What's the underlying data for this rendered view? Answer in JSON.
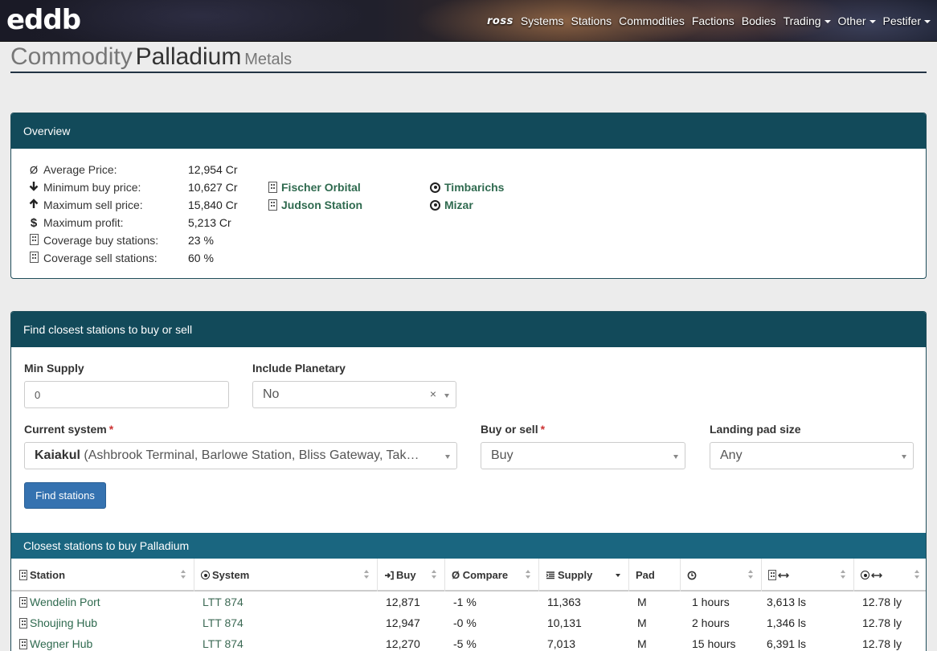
{
  "navbar": {
    "logo": "eddb",
    "brand": "ross",
    "items": [
      "Systems",
      "Stations",
      "Commodities",
      "Factions",
      "Bodies"
    ],
    "dropdowns": [
      "Trading",
      "Other",
      "Pestifer"
    ]
  },
  "header": {
    "prefix": "Commodity",
    "name": "Palladium",
    "category": "Metals"
  },
  "overview": {
    "title": "Overview",
    "rows": [
      {
        "icon": "Ø",
        "label": "Average Price:",
        "value": "12,954 Cr"
      },
      {
        "icon": "arrow-down-icon",
        "label": "Minimum buy price:",
        "value": "10,627 Cr"
      },
      {
        "icon": "arrow-up-icon",
        "label": "Maximum sell price:",
        "value": "15,840 Cr"
      },
      {
        "icon": "dollar-icon",
        "label": "Maximum profit:",
        "value": "5,213 Cr"
      },
      {
        "icon": "building-icon",
        "label": "Coverage buy stations:",
        "value": "23 %"
      },
      {
        "icon": "building-icon",
        "label": "Coverage sell stations:",
        "value": "60 %"
      }
    ],
    "min_buy_station": "Fischer Orbital",
    "max_sell_station": "Judson Station",
    "min_buy_system": "Timbarichs",
    "max_sell_system": "Mizar"
  },
  "finder": {
    "title": "Find closest stations to buy or sell",
    "min_supply_label": "Min Supply",
    "min_supply_value": "0",
    "planetary_label": "Include Planetary",
    "planetary_value": "No",
    "system_label": "Current system",
    "system_name": "Kaiakul",
    "system_stations": "(Ashbrook Terminal, Barlowe Station, Bliss Gateway, Tak…",
    "buysell_label": "Buy or sell",
    "buysell_value": "Buy",
    "pad_label": "Landing pad size",
    "pad_value": "Any",
    "required_mark": "*",
    "button": "Find stations"
  },
  "results": {
    "title": "Closest stations to buy Palladium",
    "columns": [
      "Station",
      "System",
      "Buy",
      "Ø Compare",
      "Supply",
      "Pad",
      "",
      "",
      ""
    ],
    "rows": [
      {
        "station": "Wendelin Port",
        "system": "LTT 874",
        "buy": "12,871",
        "compare": "-1 %",
        "supply": "11,363",
        "pad": "M",
        "age": "1 hours",
        "dist_star": "3,613 ls",
        "dist_ly": "12.78 ly"
      },
      {
        "station": "Shoujing Hub",
        "system": "LTT 874",
        "buy": "12,947",
        "compare": "-0 %",
        "supply": "10,131",
        "pad": "M",
        "age": "2 hours",
        "dist_star": "1,346 ls",
        "dist_ly": "12.78 ly"
      },
      {
        "station": "Wegner Hub",
        "system": "LTT 874",
        "buy": "12,270",
        "compare": "-5 %",
        "supply": "7,013",
        "pad": "M",
        "age": "15 hours",
        "dist_star": "6,391 ls",
        "dist_ly": "12.78 ly"
      }
    ]
  }
}
